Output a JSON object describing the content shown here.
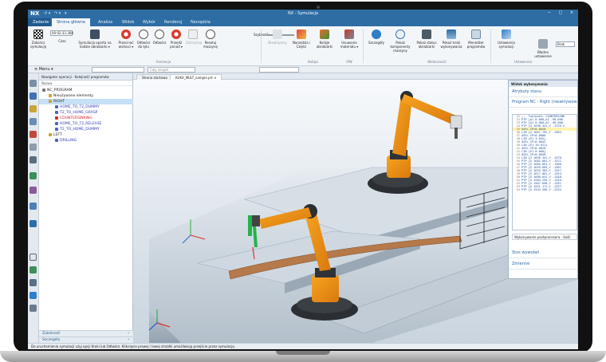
{
  "window": {
    "app_logo": "NX",
    "title": "NX - Symulacja",
    "quick_access": [
      "↺ ▾",
      "↷ ▾",
      "▾"
    ],
    "controls": [
      "−",
      "□",
      "×"
    ]
  },
  "tabs": {
    "file": "Zadanie",
    "items": [
      "Strona główna",
      "Analiza",
      "Widok",
      "Wybór",
      "Renderuj",
      "Narzędzia"
    ]
  },
  "ribbon": {
    "simulation_time": "00:02:33.368",
    "buttons": [
      {
        "label": "Zakończ symulację",
        "icon": "checkered-flag-icon"
      },
      {
        "label": "Czas",
        "icon": "clock-icon"
      },
      {
        "label": "Symulacja oparta na kodzie obrabiarki ▾",
        "icon": "code-sim-icon"
      },
      {
        "label": "Przecinać wolnoci ▾",
        "icon": "sparkle-icon"
      },
      {
        "label": "Odtwórz do tyłu",
        "icon": "play-back-icon"
      },
      {
        "label": "Odtwórz",
        "icon": "play-icon"
      },
      {
        "label": "Przejdź ponad ▾",
        "icon": "step-over-icon"
      },
      {
        "label": "Zatrzymaj",
        "icon": "stop-icon"
      },
      {
        "label": "Resetuj maszynę",
        "icon": "reset-icon"
      }
    ],
    "speed_label": "Szybkość",
    "group_animation": "Animacja",
    "buttons2": [
      {
        "label": "Nieaktywny",
        "icon": "inactive-icon"
      },
      {
        "label": "Narzędzia i Części",
        "icon": "tools-icon"
      },
      {
        "label": "Kolizje obrabiarki",
        "icon": "collision-icon"
      },
      {
        "label": "Usuwanie materiału ▾",
        "icon": "material-icon"
      },
      {
        "label": "Szczegóły",
        "icon": "info-icon"
      },
      {
        "label": "Pokaż komponenty maszyny",
        "icon": "components-icon"
      },
      {
        "label": "Pokaż status obrabiarki",
        "icon": "status-icon"
      },
      {
        "label": "Pokaż kroki wykonywania",
        "icon": "steps-icon"
      },
      {
        "label": "Menedżer programów",
        "icon": "program-manager-icon"
      },
      {
        "label": "Ustawienia symulacji",
        "icon": "settings-icon"
      },
      {
        "label": "Błędne ustawienie",
        "icon": "error-settings-icon"
      }
    ],
    "group_collisions": "Kolizja",
    "group_iPW": "iPW",
    "group_display": "Widoczność",
    "group_settings": "Ustawienia",
    "right_box": "Brak"
  },
  "toolbar": {
    "menu": "≡ Menu ▾",
    "combo1": "",
    "combo2": "Cały zespół",
    "combo3": ""
  },
  "navigator": {
    "title": "Nawigator operacji - Kolejność programów",
    "column": "Nazwa",
    "nodes": [
      {
        "label": "NC_PROGRAM",
        "indent": 0,
        "color": "#777777",
        "text_color": "#222222"
      },
      {
        "label": "Nieużywane elementy",
        "indent": 1,
        "color": "#c9a43a",
        "text_color": "#222222"
      },
      {
        "label": "RIGHT",
        "indent": 1,
        "color": "#c9a43a",
        "text_color": "#222222",
        "selected": true
      },
      {
        "label": "HOME_TO_T2_DUMMY",
        "indent": 2,
        "color": "#4f62c8",
        "text_color": "#2e3cb4"
      },
      {
        "label": "T2_TO_HOME_GRASP",
        "indent": 2,
        "color": "#4f62c8",
        "text_color": "#2e3cb4"
      },
      {
        "label": "COUNTERSINKING",
        "indent": 2,
        "color": "#c9302c",
        "text_color": "#d4222c"
      },
      {
        "label": "HOME_TO_T2_RELEASE",
        "indent": 2,
        "color": "#4f62c8",
        "text_color": "#2e3cb4"
      },
      {
        "label": "T2_TO_HOME_DUMMY",
        "indent": 2,
        "color": "#4f62c8",
        "text_color": "#2e3cb4"
      },
      {
        "label": "LEFT",
        "indent": 1,
        "color": "#c9a43a",
        "text_color": "#222222"
      },
      {
        "label": "DRILLING",
        "indent": 2,
        "color": "#4f62c8",
        "text_color": "#2e3cb4"
      }
    ],
    "footer1": "Zależność",
    "footer2": "Szczegóły"
  },
  "graphics": {
    "tabs": [
      "Strona startowa",
      "KUKA_MULT_sample.prt ✕"
    ]
  },
  "sim_panel": {
    "title": "Widok wykonywania",
    "section1": "Atrybuty stanu",
    "section2": "Program NC - Right (nieaktywowa",
    "code": [
      {
        "n": "31",
        "t": ";-- Toolpath: COUNTERSINK"
      },
      {
        "n": "32",
        "t": "PTP {A1 0.000,A2 -90.000"
      },
      {
        "n": "33",
        "t": "PTP {A1 0.000,A2 -90.000"
      },
      {
        "n": "34",
        "t": "PTP {X 1698.341,Y -1376.2"
      },
      {
        "n": "35",
        "t": "$VEL.CP=0.0020",
        "cur": true
      },
      {
        "n": "36",
        "t": "LIN {X 1667.792,Y -1362."
      },
      {
        "n": "37",
        "t": "$VEL.CP=0.0080"
      },
      {
        "n": "38",
        "t": "LIN {E1 3.026}"
      },
      {
        "n": "39",
        "t": "$VEL.CP=0.0042"
      },
      {
        "n": "40",
        "t": "LIN {E1 16.621}"
      },
      {
        "n": "41",
        "t": "$VEL.CP=0.0020"
      },
      {
        "n": "42",
        "t": "LIN {E1 0.000}"
      },
      {
        "n": "43",
        "t": "$VEL.CP=0.0050"
      },
      {
        "n": "44",
        "t": "LIN {X 1696.341,Y -1376."
      },
      {
        "n": "45",
        "t": "PTP {X 1682.801,Y -1371."
      },
      {
        "n": "46",
        "t": "PTP {X 1665.091,Y -1366."
      },
      {
        "n": "47",
        "t": "PTP {X 1649.665,Y -1361."
      },
      {
        "n": "48",
        "t": "PTP {X 1633.382,Y -1357."
      },
      {
        "n": "49",
        "t": "PTP {X 1617.061,Y -1353."
      },
      {
        "n": "50",
        "t": "PTP {X 1600.641,Y -1348."
      },
      {
        "n": "51",
        "t": "PTP {X 1584.295,Y -1344."
      },
      {
        "n": "52",
        "t": "PTP {X 1567.696,Y -1341."
      },
      {
        "n": "53",
        "t": "PTP {X 1551.171,Y -1337."
      },
      {
        "n": "54",
        "t": "PTP {X 1534.596,Y -2334."
      }
    ],
    "post": "Wykonywanie postprocesora - Ilość",
    "section3": "Stos wywołań",
    "section4": "Zmienne"
  },
  "status": "Do uruchomienia symulacji użyj opcji Kroki lub Odtwórz. Kliknięcie prawej i lewej strzałki umożliwiają przejście przez symulację."
}
